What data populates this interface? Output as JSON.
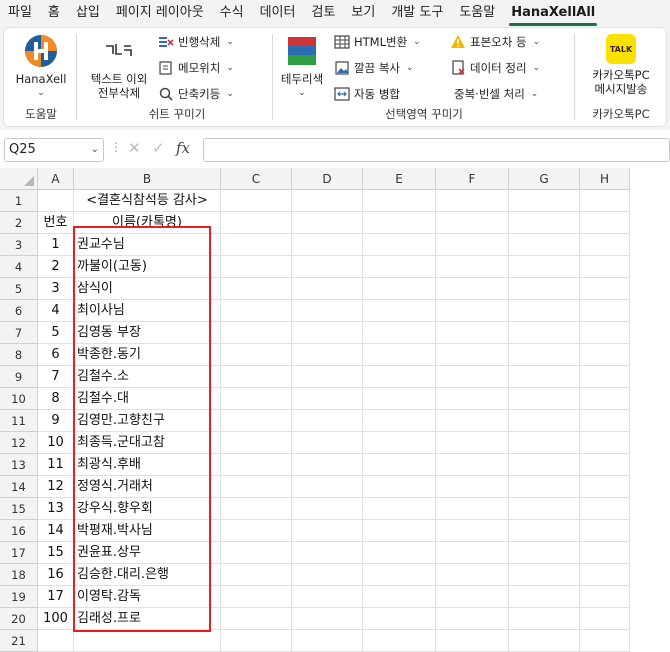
{
  "menu": {
    "tabs": [
      "파일",
      "홈",
      "삽입",
      "페이지 레이아웃",
      "수식",
      "데이터",
      "검토",
      "보기",
      "개발 도구",
      "도움말",
      "HanaXellAll"
    ],
    "active_index": 10
  },
  "ribbon": {
    "hanaxell": {
      "label": "HanaXell",
      "group_label": "도움말"
    },
    "sheet_group": {
      "big_label_1": "텍스트 이외",
      "big_label_2": "전부삭제",
      "items": [
        "빈행삭제",
        "메모위치",
        "단축키등"
      ],
      "group_label": "쉬트 꾸미기"
    },
    "select_group": {
      "big_label": "테두리색",
      "items": [
        "HTML변환",
        "깔끔 복사",
        "자동 병합",
        "표본오차 등",
        "데이터 정리",
        "중복·빈셀 처리"
      ],
      "group_label": "선택영역 꾸미기"
    },
    "kakao_group": {
      "big_label_1": "카카오톡PC",
      "big_label_2": "메시지발송",
      "icon_text": "TALK",
      "group_label": "카카오톡PC"
    }
  },
  "formula_bar": {
    "name_box": "Q25",
    "fx": "fx",
    "value": ""
  },
  "sheet": {
    "columns": [
      "A",
      "B",
      "C",
      "D",
      "E",
      "F",
      "G",
      "H"
    ],
    "rows": [
      "1",
      "2",
      "3",
      "4",
      "5",
      "6",
      "7",
      "8",
      "9",
      "10",
      "11",
      "12",
      "13",
      "14",
      "15",
      "16",
      "17",
      "18",
      "19",
      "20",
      "21"
    ],
    "title": "<결혼식참석등 감사>",
    "header_a": "번호",
    "header_b": "이름(카톡명)",
    "entries": [
      {
        "no": "1",
        "name": "권교수님"
      },
      {
        "no": "2",
        "name": "까불이(고동)"
      },
      {
        "no": "3",
        "name": "삼식이"
      },
      {
        "no": "4",
        "name": "최이사님"
      },
      {
        "no": "5",
        "name": "김영동 부장"
      },
      {
        "no": "6",
        "name": "박종한.동기"
      },
      {
        "no": "7",
        "name": "김철수.소"
      },
      {
        "no": "8",
        "name": "김철수.대"
      },
      {
        "no": "9",
        "name": "김영만.고향친구"
      },
      {
        "no": "10",
        "name": "최종득.군대고참"
      },
      {
        "no": "11",
        "name": "최광식.후배"
      },
      {
        "no": "12",
        "name": "정영식.거래처"
      },
      {
        "no": "13",
        "name": "강우식.향우회"
      },
      {
        "no": "14",
        "name": "박평재.박사님"
      },
      {
        "no": "15",
        "name": "권윤표.상무"
      },
      {
        "no": "16",
        "name": "김승한.대리.은행"
      },
      {
        "no": "17",
        "name": "이영탁.감독"
      },
      {
        "no": "100",
        "name": "김래성.프로"
      }
    ],
    "highlight_color": "#e8201c"
  }
}
